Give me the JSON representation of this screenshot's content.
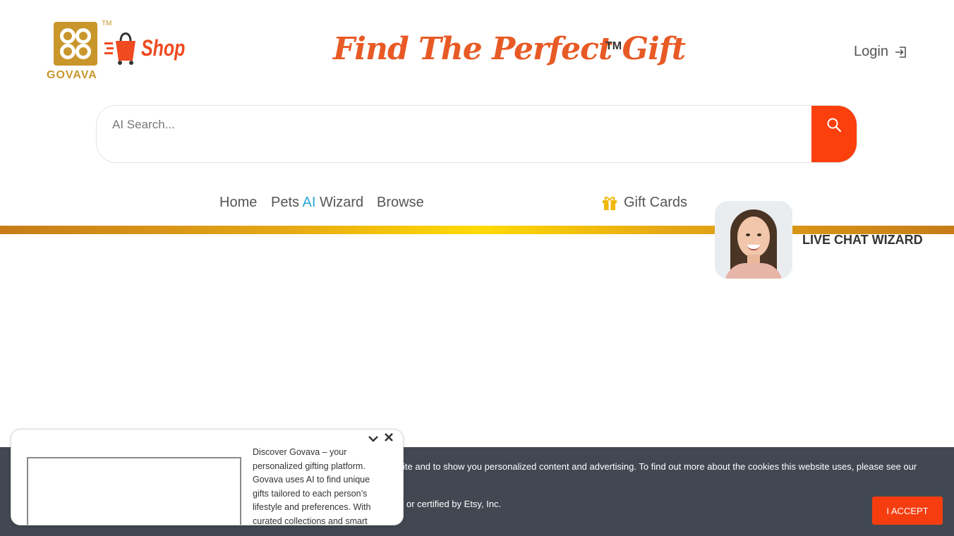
{
  "logo": {
    "wordmark": "GOVAVA",
    "tm": "TM",
    "shop_label": "Shop"
  },
  "header": {
    "title": "Find The Perfect Gift",
    "title_tm": "TM",
    "login_label": "Login"
  },
  "search": {
    "placeholder": "AI Search...",
    "value": ""
  },
  "nav": {
    "home": "Home",
    "pets": "Pets",
    "ai": "AI",
    "wizard": "Wizard",
    "browse": "Browse",
    "gift_cards": "Gift Cards"
  },
  "live_chat": {
    "label": "LIVE CHAT WIZARD"
  },
  "cookie": {
    "line1": "ite and to show you personalized content and advertising. To find out more about the cookies this website uses, please see our",
    "line2": "or certified by Etsy, Inc.",
    "accept_label": "I ACCEPT"
  },
  "popup": {
    "text": "Discover Govava – your personalized gifting platform. Govava uses AI to find unique gifts tailored to each person’s lifestyle and preferences. With curated collections and smart"
  },
  "colors": {
    "accent": "#fb3f0d",
    "gold": "#c9962c",
    "title": "#e85a25",
    "ai_blue": "#2aa7d6",
    "cookie_bg": "#414852"
  }
}
